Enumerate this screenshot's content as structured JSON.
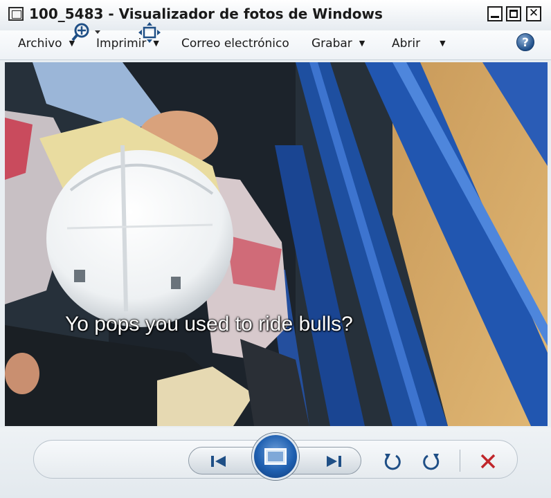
{
  "window": {
    "title": "100_5483 - Visualizador de fotos de Windows"
  },
  "menu": [
    {
      "label": "Archivo",
      "has_dropdown": true
    },
    {
      "label": "Imprimir",
      "has_dropdown": true
    },
    {
      "label": "Correo electrónico",
      "has_dropdown": false
    },
    {
      "label": "Grabar",
      "has_dropdown": true
    },
    {
      "label": "Abrir",
      "has_dropdown": true
    }
  ],
  "help": {
    "label": "?"
  },
  "photo": {
    "caption": "Yo pops you used to ride bulls?"
  },
  "controls": {
    "icons": [
      "zoom-icon",
      "fit-to-window-icon",
      "previous-icon",
      "slideshow-icon",
      "next-icon",
      "rotate-left-icon",
      "rotate-right-icon",
      "delete-icon"
    ],
    "accent": "#1f4f86",
    "delete_color": "#c0262b"
  }
}
